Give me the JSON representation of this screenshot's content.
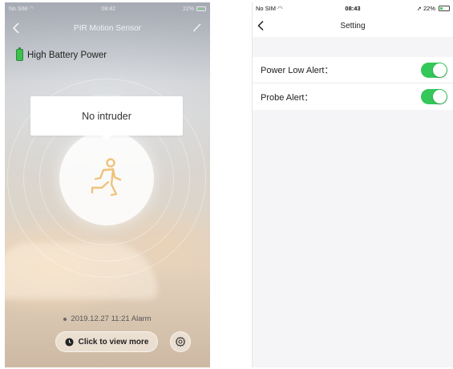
{
  "left_screen": {
    "status_bar": {
      "carrier": "No SIM",
      "time": "08:42",
      "battery": "22%"
    },
    "nav": {
      "title": "PIR Motion Sensor"
    },
    "battery_label": "High Battery Power",
    "bubble_text": "No intruder",
    "alarm_text": "2019.12.27 11:21 Alarm",
    "view_more_label": "Click to view more",
    "colors": {
      "motion_icon": "#f0c27a",
      "battery": "#3fbf4f"
    }
  },
  "right_screen": {
    "status_bar": {
      "carrier": "No SIM",
      "time": "08:43",
      "battery": "22%"
    },
    "nav": {
      "title": "Setting"
    },
    "settings": [
      {
        "label": "Power Low Alert：",
        "enabled": true
      },
      {
        "label": "Probe Alert：",
        "enabled": true
      }
    ],
    "colors": {
      "toggle_on": "#34c759"
    }
  }
}
